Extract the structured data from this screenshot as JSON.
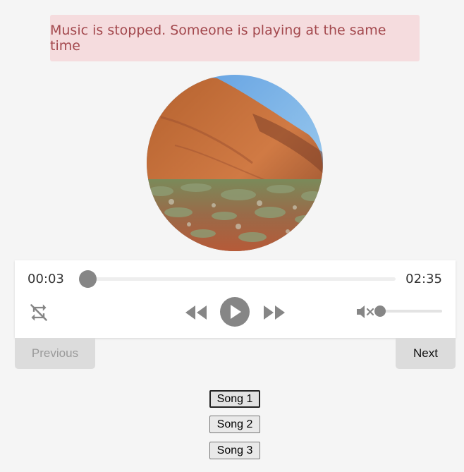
{
  "alert": {
    "message": "Music is stopped. Someone is playing at the same time"
  },
  "album_art": {
    "subject": "red rock formation with desert scrub under blue sky"
  },
  "player": {
    "current_time": "00:03",
    "duration": "02:35",
    "progress_fraction": 0.02,
    "volume_fraction": 0.0,
    "muted": true,
    "icons": {
      "repeat": "repeat-off-icon",
      "rewind": "rewind-icon",
      "play": "play-icon",
      "forward": "fast-forward-icon",
      "mute": "volume-muted-icon"
    }
  },
  "navigation": {
    "previous_label": "Previous",
    "next_label": "Next",
    "previous_disabled": true
  },
  "playlist": {
    "songs": [
      "Song 1",
      "Song 2",
      "Song 3"
    ],
    "active_index": 0
  },
  "colors": {
    "alert_bg": "#f5dcde",
    "alert_text": "#a3484d",
    "control": "#868686"
  }
}
